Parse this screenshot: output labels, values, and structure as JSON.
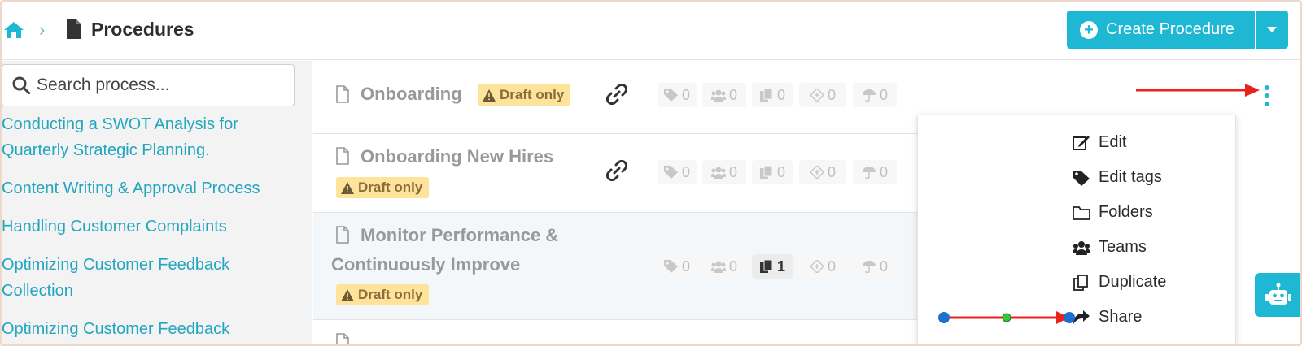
{
  "header": {
    "breadcrumb_sep": "›",
    "title": "Procedures",
    "create_label": "Create Procedure"
  },
  "search": {
    "placeholder": "Search process..."
  },
  "sidebar": {
    "links": [
      "Conducting a SWOT Analysis for",
      "Quarterly Strategic Planning.",
      "Content Writing & Approval Process",
      "Handling Customer Complaints",
      "Optimizing Customer Feedback",
      "Collection",
      "Optimizing Customer Feedback"
    ]
  },
  "rows": [
    {
      "title": "Onboarding",
      "badge": "Draft only",
      "stats": [
        "0",
        "0",
        "0",
        "0",
        "0"
      ]
    },
    {
      "title": "Onboarding New Hires",
      "badge": "Draft only",
      "stats": [
        "0",
        "0",
        "0",
        "0",
        "0"
      ]
    },
    {
      "title_line1": "Monitor Performance &",
      "title_line2": "Continuously Improve",
      "badge": "Draft only",
      "stats": [
        "0",
        "0",
        "1",
        "0",
        "0"
      ]
    }
  ],
  "menu": {
    "items": [
      "Edit",
      "Edit tags",
      "Folders",
      "Teams",
      "Duplicate",
      "Share"
    ]
  },
  "colors": {
    "accent": "#1fb8d4",
    "badge_bg": "#fde49a",
    "annotation_red": "#e8231c"
  }
}
